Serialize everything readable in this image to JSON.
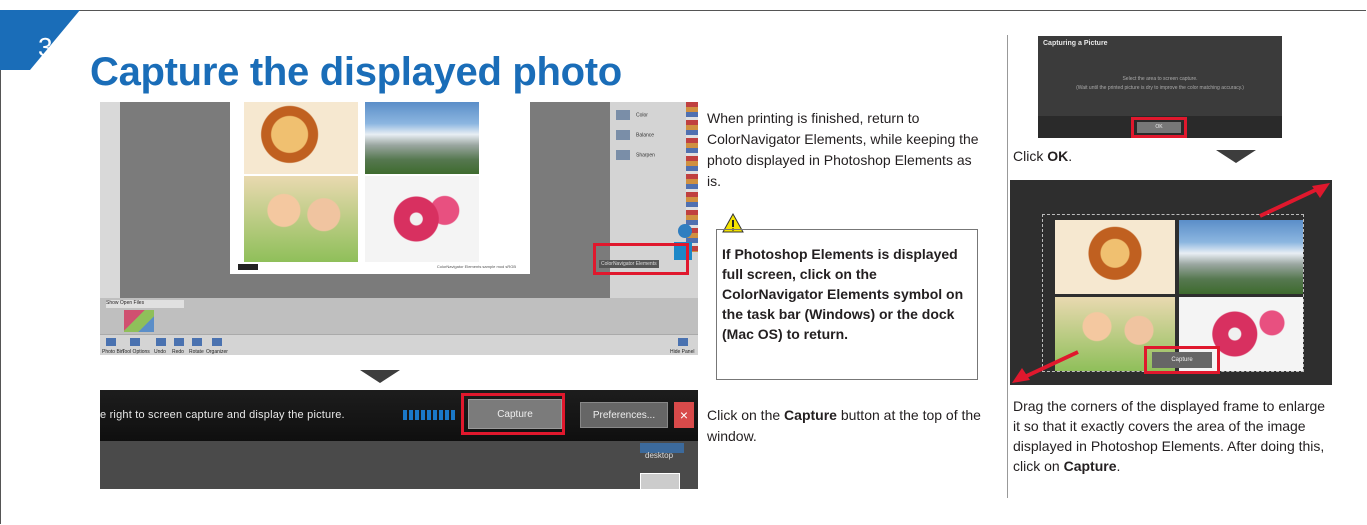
{
  "step": {
    "number": "3"
  },
  "title": "Capture the displayed photo",
  "colors": {
    "accent": "#1a6db8",
    "highlight": "#e0182d"
  },
  "ps_screenshot": {
    "panel_items": [
      "Color",
      "Balance",
      "Sharpen"
    ],
    "open_files_label": "Show Open Files",
    "photo_caption": "ColorNavigator Elements sample mod sRGB",
    "taskbar_label": "ColorNavigator Elements",
    "footer_buttons": [
      "Photo Bin",
      "Tool Options",
      "Undo",
      "Redo",
      "Rotate",
      "Organizer"
    ],
    "hide_panel": "Hide Panel"
  },
  "capture_bar": {
    "message": "e right to screen capture and display the picture.",
    "capture_button": "Capture",
    "preferences_button": "Preferences...",
    "close_glyph": "×",
    "desktop_label": "desktop"
  },
  "instructions": {
    "return_text": "When printing is finished, return to ColorNavigator Elements, while keeping the photo displayed in Photoshop Elements as is.",
    "warning": "If Photoshop Elements is displayed full screen, click on the ColorNavigator Elements symbol on the task bar (Windows) or the dock (Mac OS) to return.",
    "capture_prefix": "Click on the ",
    "capture_bold": "Capture",
    "capture_suffix": " button at the top of the window."
  },
  "dialog": {
    "title": "Capturing a Picture",
    "line1": "Select the area to screen capture.",
    "line2": "(Wait until the printed picture is dry to improve the color matching accuracy.)",
    "ok_button": "OK"
  },
  "click_ok": {
    "prefix": "Click ",
    "bold": "OK",
    "suffix": "."
  },
  "capture_window": {
    "button": "Capture"
  },
  "drag_text": {
    "main": "Drag the corners of the displayed frame to enlarge it so that it exactly covers the area of the image displayed in Photoshop Elements. After doing this, click on ",
    "bold": "Capture",
    "suffix": "."
  }
}
